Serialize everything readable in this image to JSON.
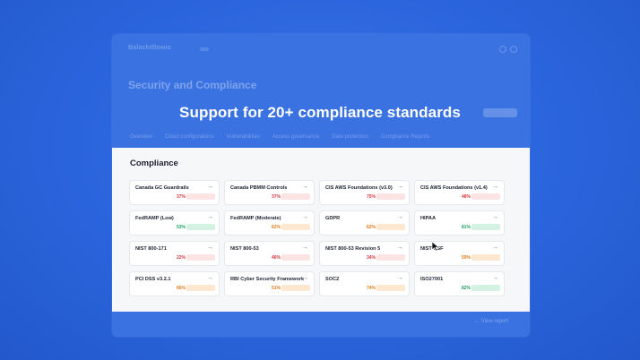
{
  "background_app": {
    "logo": "Balachtflowio",
    "title": "Security and Compliance",
    "tabs": [
      "Overview",
      "Cloud configurations",
      "Vulnerabilities",
      "Access governance",
      "Data protection",
      "Compliance Reports"
    ],
    "footer_link": "← View report"
  },
  "headline": "Support for 20+ compliance standards",
  "compliance": {
    "title": "Compliance",
    "cards": [
      {
        "name": "Canada GC Guardrails",
        "percent": "37%",
        "status": "red"
      },
      {
        "name": "Canada PBMM Controls",
        "percent": "37%",
        "status": "red"
      },
      {
        "name": "CIS AWS Foundations (v3.0)",
        "percent": "75%",
        "status": "red"
      },
      {
        "name": "CIS AWS Foundations (v1.4)",
        "percent": "48%",
        "status": "red"
      },
      {
        "name": "FedRAMP (Low)",
        "percent": "53%",
        "status": "green"
      },
      {
        "name": "FedRAMP (Moderate)",
        "percent": "62%",
        "status": "orange"
      },
      {
        "name": "GDPR",
        "percent": "62%",
        "status": "orange"
      },
      {
        "name": "HIPAA",
        "percent": "81%",
        "status": "green"
      },
      {
        "name": "NIST 800-171",
        "percent": "22%",
        "status": "red"
      },
      {
        "name": "NIST 800-53",
        "percent": "46%",
        "status": "red"
      },
      {
        "name": "NIST 800-53 Revision 5",
        "percent": "34%",
        "status": "red"
      },
      {
        "name": "NIST CSF",
        "percent": "59%",
        "status": "orange"
      },
      {
        "name": "PCI DSS v3.2.1",
        "percent": "66%",
        "status": "orange"
      },
      {
        "name": "RBI Cyber Security Framework",
        "percent": "51%",
        "status": "orange"
      },
      {
        "name": "SOC2",
        "percent": "74%",
        "status": "orange"
      },
      {
        "name": "ISO27001",
        "percent": "82%",
        "status": "green"
      }
    ],
    "arrow": "→"
  },
  "colors": {
    "background": "#2a64dc",
    "red": "#d9363e",
    "orange": "#e07b1a",
    "green": "#1f9d61"
  },
  "icons": {
    "card_arrow": "arrow-right-icon",
    "cursor": "mouse-pointer-icon"
  }
}
